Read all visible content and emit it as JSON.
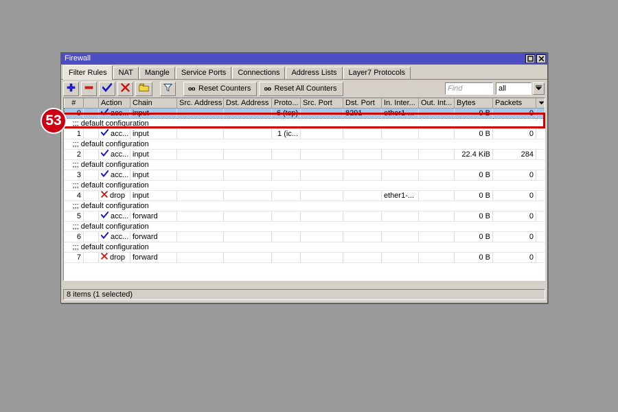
{
  "window": {
    "title": "Firewall",
    "controls": [
      {
        "name": "maximize-button",
        "icon": "maximize-icon"
      },
      {
        "name": "close-button",
        "icon": "close-icon"
      }
    ]
  },
  "tabs": [
    {
      "label": "Filter Rules",
      "active": true
    },
    {
      "label": "NAT",
      "active": false
    },
    {
      "label": "Mangle",
      "active": false
    },
    {
      "label": "Service Ports",
      "active": false
    },
    {
      "label": "Connections",
      "active": false
    },
    {
      "label": "Address Lists",
      "active": false
    },
    {
      "label": "Layer7 Protocols",
      "active": false
    }
  ],
  "toolbar": {
    "add_icon": "plus-icon",
    "remove_icon": "minus-icon",
    "enable_icon": "check-icon",
    "disable_icon": "cross-icon",
    "comment_icon": "comment-folder-icon",
    "filter_icon": "funnel-icon",
    "reset_counters_label": "Reset Counters",
    "reset_counters_prefix": "oo",
    "reset_all_counters_label": "Reset All Counters",
    "reset_all_counters_prefix": "oo",
    "find_placeholder": "Find",
    "find_value": "",
    "filter_select_value": "all",
    "dropdown_icon": "chevron-down-icon"
  },
  "table": {
    "columns": [
      {
        "key": "num",
        "label": "#"
      },
      {
        "key": "flag",
        "label": ""
      },
      {
        "key": "action",
        "label": "Action"
      },
      {
        "key": "chain",
        "label": "Chain"
      },
      {
        "key": "src_address",
        "label": "Src. Address"
      },
      {
        "key": "dst_address",
        "label": "Dst. Address"
      },
      {
        "key": "protocol",
        "label": "Proto..."
      },
      {
        "key": "src_port",
        "label": "Src. Port"
      },
      {
        "key": "dst_port",
        "label": "Dst. Port"
      },
      {
        "key": "in_interface",
        "label": "In. Inter..."
      },
      {
        "key": "out_interface",
        "label": "Out. Int..."
      },
      {
        "key": "bytes",
        "label": "Bytes"
      },
      {
        "key": "packets",
        "label": "Packets"
      }
    ],
    "comment_text": ";;; default configuration",
    "rows": [
      {
        "num": "0",
        "action": "acc...",
        "action_icon": "check-icon",
        "chain": "input",
        "src_address": "",
        "dst_address": "",
        "protocol": "6 (tcp)",
        "src_port": "",
        "dst_port": "8291",
        "in_interface": "ether1-...",
        "out_interface": "",
        "bytes": "0 B",
        "packets": "0",
        "selected": true,
        "comment_above": false
      },
      {
        "num": "1",
        "action": "acc...",
        "action_icon": "check-icon",
        "chain": "input",
        "src_address": "",
        "dst_address": "",
        "protocol": "1 (ic...",
        "src_port": "",
        "dst_port": "",
        "in_interface": "",
        "out_interface": "",
        "bytes": "0 B",
        "packets": "0",
        "selected": false,
        "comment_above": true
      },
      {
        "num": "2",
        "action": "acc...",
        "action_icon": "check-icon",
        "chain": "input",
        "src_address": "",
        "dst_address": "",
        "protocol": "",
        "src_port": "",
        "dst_port": "",
        "in_interface": "",
        "out_interface": "",
        "bytes": "22.4 KiB",
        "packets": "284",
        "selected": false,
        "comment_above": true
      },
      {
        "num": "3",
        "action": "acc...",
        "action_icon": "check-icon",
        "chain": "input",
        "src_address": "",
        "dst_address": "",
        "protocol": "",
        "src_port": "",
        "dst_port": "",
        "in_interface": "",
        "out_interface": "",
        "bytes": "0 B",
        "packets": "0",
        "selected": false,
        "comment_above": true
      },
      {
        "num": "4",
        "action": "drop",
        "action_icon": "cross-icon",
        "chain": "input",
        "src_address": "",
        "dst_address": "",
        "protocol": "",
        "src_port": "",
        "dst_port": "",
        "in_interface": "ether1-...",
        "out_interface": "",
        "bytes": "0 B",
        "packets": "0",
        "selected": false,
        "comment_above": true
      },
      {
        "num": "5",
        "action": "acc...",
        "action_icon": "check-icon",
        "chain": "forward",
        "src_address": "",
        "dst_address": "",
        "protocol": "",
        "src_port": "",
        "dst_port": "",
        "in_interface": "",
        "out_interface": "",
        "bytes": "0 B",
        "packets": "0",
        "selected": false,
        "comment_above": true
      },
      {
        "num": "6",
        "action": "acc...",
        "action_icon": "check-icon",
        "chain": "forward",
        "src_address": "",
        "dst_address": "",
        "protocol": "",
        "src_port": "",
        "dst_port": "",
        "in_interface": "",
        "out_interface": "",
        "bytes": "0 B",
        "packets": "0",
        "selected": false,
        "comment_above": true
      },
      {
        "num": "7",
        "action": "drop",
        "action_icon": "cross-icon",
        "chain": "forward",
        "src_address": "",
        "dst_address": "",
        "protocol": "",
        "src_port": "",
        "dst_port": "",
        "in_interface": "",
        "out_interface": "",
        "bytes": "0 B",
        "packets": "0",
        "selected": false,
        "comment_above": true
      }
    ]
  },
  "statusbar": {
    "text": "8 items (1 selected)"
  },
  "annotation": {
    "badge_number": "53"
  },
  "colors": {
    "titlebar": "#4d4dc4",
    "window_face": "#d4d0c8",
    "selection": "#a6c7e8",
    "annotation_red": "#cc0000",
    "badge_red": "#cc0014"
  }
}
